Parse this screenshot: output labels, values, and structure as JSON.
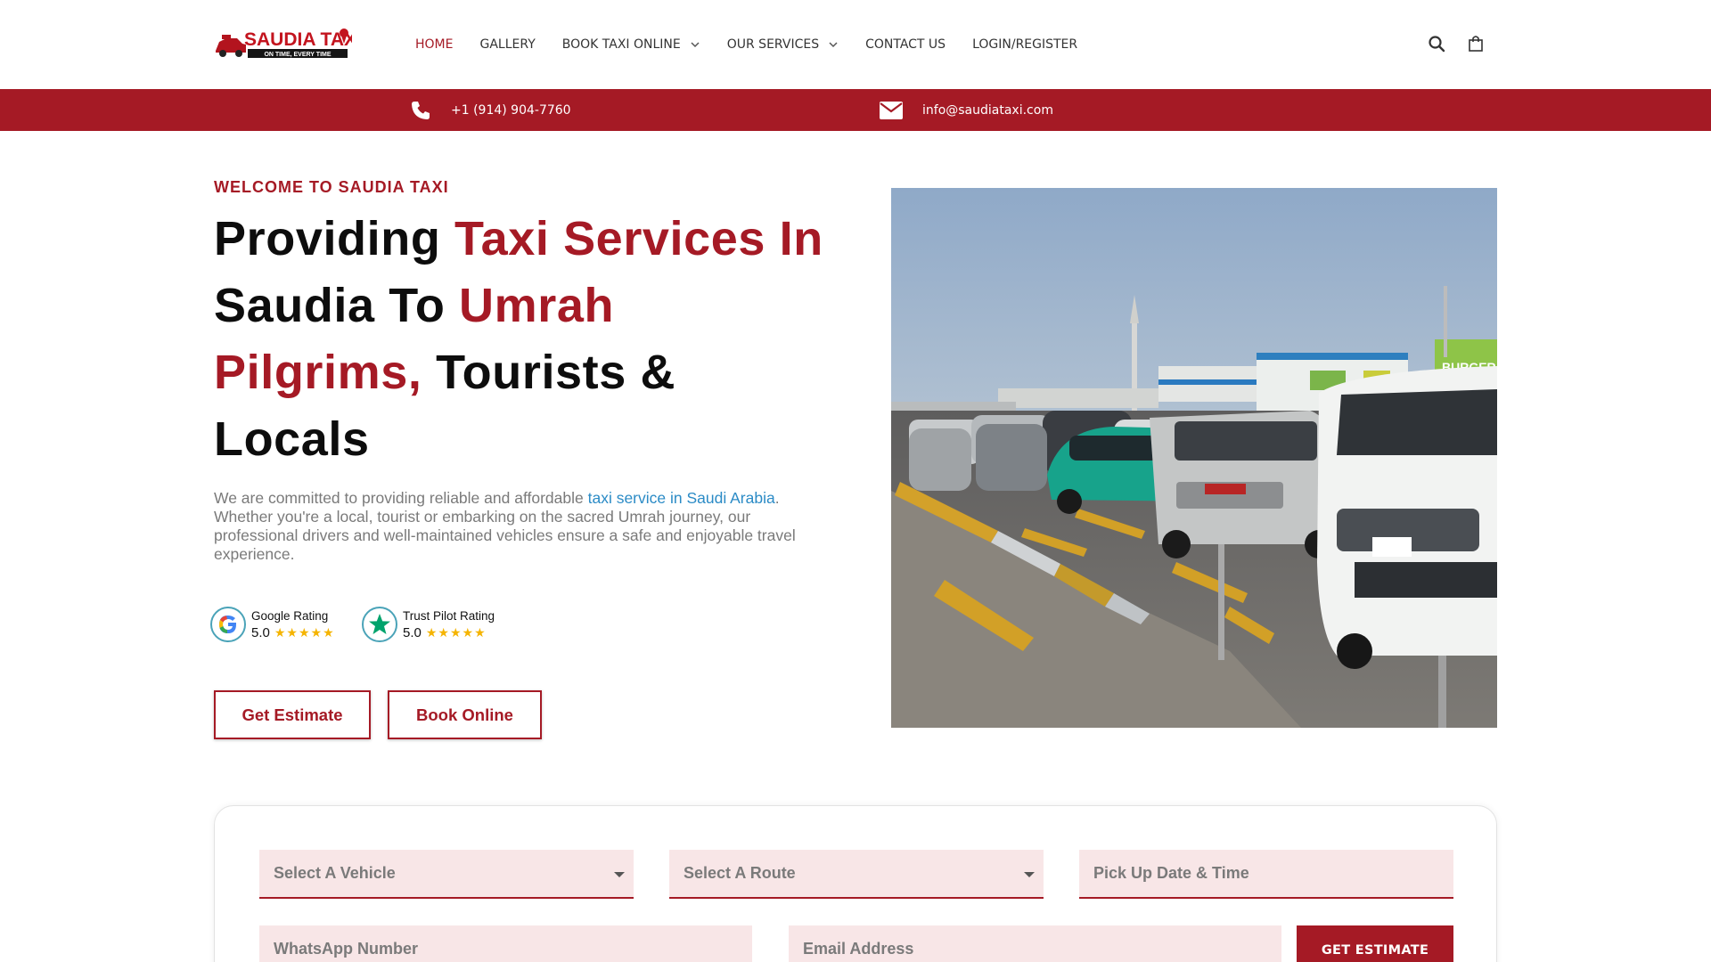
{
  "brand": {
    "logo_text": "SAUDIA TAXI",
    "logo_tagline": "ON TIME, EVERY TIME",
    "primary_color": "#a51a25",
    "link_color": "#2b8bc6"
  },
  "nav": {
    "items": [
      {
        "label": "HOME",
        "active": true
      },
      {
        "label": "GALLERY"
      },
      {
        "label": "BOOK TAXI ONLINE",
        "dropdown": true
      },
      {
        "label": "OUR SERVICES",
        "dropdown": true
      },
      {
        "label": "CONTACT US"
      },
      {
        "label": "LOGIN/REGISTER"
      }
    ],
    "icons": [
      "search-icon",
      "shopping-bag-icon"
    ]
  },
  "contact": {
    "phone": "+1 (914) 904-7760",
    "email": "info@saudiataxi.com",
    "icons": [
      "phone-icon",
      "envelope-icon"
    ]
  },
  "hero": {
    "eyebrow": "WELCOME TO SAUDIA TAXI",
    "headline": {
      "part1": "Providing ",
      "part2": "Taxi Services In",
      "part3": "Saudia To ",
      "part4": "Umrah",
      "part5": "Pilgrims,",
      "part6": " Tourists &",
      "part7": "Locals"
    },
    "intro": {
      "before_link": "We are committed to providing reliable and affordable ",
      "link": "taxi service in Saudi Arabia",
      "after_link": ". Whether you're a local, tourist or embarking on the sacred Umrah journey, our professional drivers and well-maintained vehicles ensure a safe and enjoyable travel experience."
    },
    "ratings": [
      {
        "label": "Google Rating",
        "score": "5.0",
        "stars": "★★★★★",
        "icon": "google-icon"
      },
      {
        "label": "Trust Pilot Rating",
        "score": "5.0",
        "stars": "★★★★★",
        "icon": "trustpilot-star-icon"
      }
    ],
    "buttons": {
      "estimate": "Get Estimate",
      "book": "Book Online"
    },
    "photo_sign": "BURGER"
  },
  "form": {
    "vehicle": "Select A Vehicle",
    "route": "Select A Route",
    "pickup": "Pick Up Date & Time",
    "whatsapp": "WhatsApp Number",
    "email": "Email Address",
    "submit": "GET ESTIMATE"
  }
}
